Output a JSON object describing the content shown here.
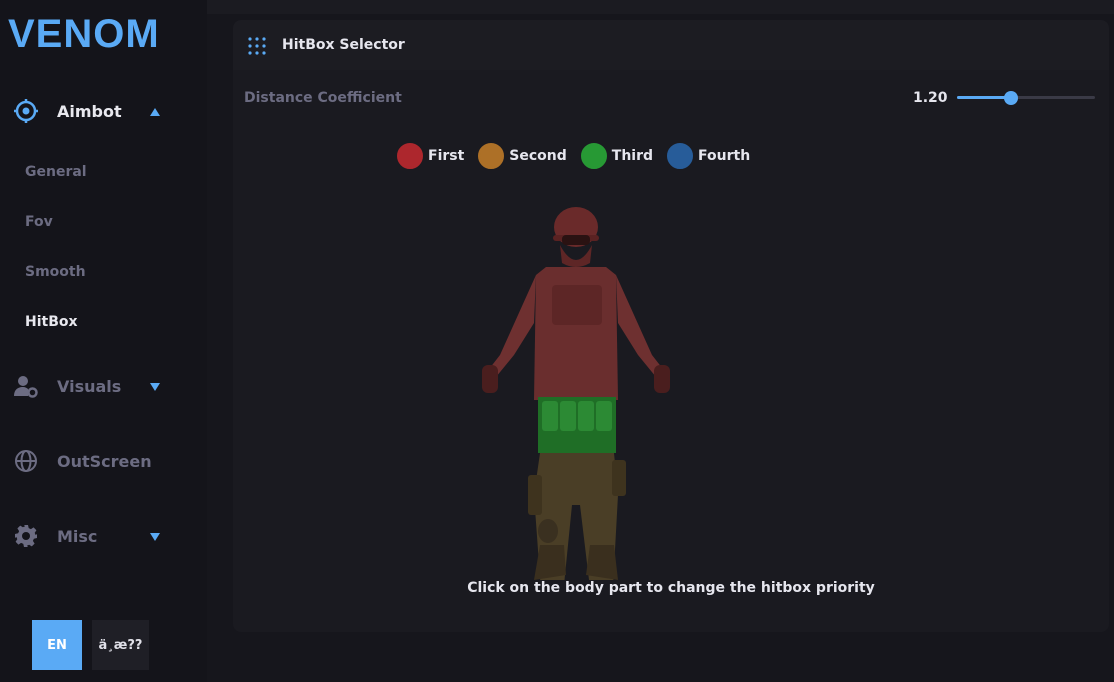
{
  "app": {
    "logo": "VENOM"
  },
  "sidebar": {
    "items": [
      {
        "label": "Aimbot",
        "icon": "crosshair-icon",
        "expanded": true
      },
      {
        "label": "Visuals",
        "icon": "user-gear-icon",
        "expanded": false
      },
      {
        "label": "OutScreen",
        "icon": "globe-icon"
      },
      {
        "label": "Misc",
        "icon": "gear-icon",
        "expanded": false
      }
    ],
    "aimbot_sub": [
      "General",
      "Fov",
      "Smooth",
      "HitBox"
    ],
    "active_sub": "HitBox"
  },
  "lang": {
    "en": "EN",
    "other": "ä¸­æ??"
  },
  "panel": {
    "title": "HitBox Selector",
    "distance_label": "Distance Coefficient",
    "distance_value": "1.20",
    "slider_fraction": 0.39,
    "legend": [
      {
        "label": "First",
        "color": "#8a1f24"
      },
      {
        "label": "Second",
        "color": "#8a5a1f"
      },
      {
        "label": "Third",
        "color": "#1f7a2a"
      },
      {
        "label": "Fourth",
        "color": "#1f4a7a"
      }
    ],
    "hint": "Click on the body part to change the hitbox priority"
  },
  "colors": {
    "accent": "#5aaaf5"
  }
}
